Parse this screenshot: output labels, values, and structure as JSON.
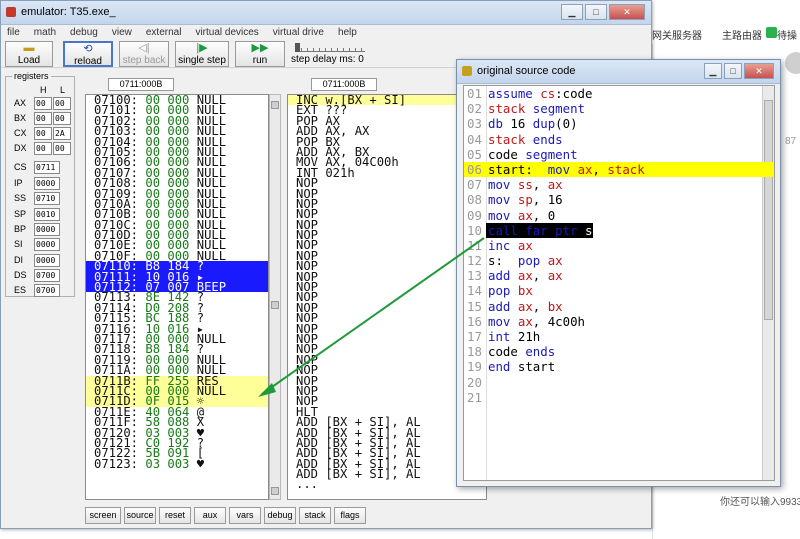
{
  "emulator": {
    "title": "emulator: T35.exe_",
    "menu": [
      "file",
      "math",
      "debug",
      "view",
      "external",
      "virtual devices",
      "virtual drive",
      "help"
    ],
    "toolbar": {
      "load": "Load",
      "reload": "reload",
      "step_back": "step back",
      "single_step": "single step",
      "run": "run",
      "step_delay": "step delay ms: 0"
    },
    "registers": {
      "title": "registers",
      "h": "H",
      "l": "L",
      "ax": {
        "name": "AX",
        "h": "00",
        "l": "00"
      },
      "bx": {
        "name": "BX",
        "h": "00",
        "l": "00"
      },
      "cx": {
        "name": "CX",
        "h": "00",
        "l": "2A"
      },
      "dx": {
        "name": "DX",
        "h": "00",
        "l": "00"
      },
      "cs": {
        "name": "CS",
        "v": "0711"
      },
      "ip": {
        "name": "IP",
        "v": "0000"
      },
      "ss": {
        "name": "SS",
        "v": "0710"
      },
      "sp": {
        "name": "SP",
        "v": "0010"
      },
      "bp": {
        "name": "BP",
        "v": "0000"
      },
      "si": {
        "name": "SI",
        "v": "0000"
      },
      "di": {
        "name": "DI",
        "v": "0000"
      },
      "ds": {
        "name": "DS",
        "v": "0700"
      },
      "es": {
        "name": "ES",
        "v": "0700"
      }
    },
    "mem_addr": "0711:000B",
    "dis_addr": "0711:000B",
    "memory": [
      {
        "addr": "07100:",
        "hex": " 00 000",
        "txt": " NULL"
      },
      {
        "addr": "07101:",
        "hex": " 00 000",
        "txt": " NULL"
      },
      {
        "addr": "07102:",
        "hex": " 00 000",
        "txt": " NULL"
      },
      {
        "addr": "07103:",
        "hex": " 00 000",
        "txt": " NULL"
      },
      {
        "addr": "07104:",
        "hex": " 00 000",
        "txt": " NULL"
      },
      {
        "addr": "07105:",
        "hex": " 00 000",
        "txt": " NULL"
      },
      {
        "addr": "07106:",
        "hex": " 00 000",
        "txt": " NULL"
      },
      {
        "addr": "07107:",
        "hex": " 00 000",
        "txt": " NULL"
      },
      {
        "addr": "07108:",
        "hex": " 00 000",
        "txt": " NULL"
      },
      {
        "addr": "07109:",
        "hex": " 00 000",
        "txt": " NULL"
      },
      {
        "addr": "0710A:",
        "hex": " 00 000",
        "txt": " NULL"
      },
      {
        "addr": "0710B:",
        "hex": " 00 000",
        "txt": " NULL"
      },
      {
        "addr": "0710C:",
        "hex": " 00 000",
        "txt": " NULL"
      },
      {
        "addr": "0710D:",
        "hex": " 00 000",
        "txt": " NULL"
      },
      {
        "addr": "0710E:",
        "hex": " 00 000",
        "txt": " NULL"
      },
      {
        "addr": "0710F:",
        "hex": " 00 000",
        "txt": " NULL"
      },
      {
        "addr": "07110:",
        "hex": " B8 184",
        "txt": " ?"
      },
      {
        "addr": "07111:",
        "hex": " 10 016",
        "txt": " ▸"
      },
      {
        "addr": "07112:",
        "hex": " 07 007",
        "txt": " BEEP"
      },
      {
        "addr": "07113:",
        "hex": " 8E 142",
        "txt": " ?"
      },
      {
        "addr": "07114:",
        "hex": " D0 208",
        "txt": " ?"
      },
      {
        "addr": "07115:",
        "hex": " BC 188",
        "txt": " ?"
      },
      {
        "addr": "07116:",
        "hex": " 10 016",
        "txt": " ▸"
      },
      {
        "addr": "07117:",
        "hex": " 00 000",
        "txt": " NULL"
      },
      {
        "addr": "07118:",
        "hex": " B8 184",
        "txt": " ?"
      },
      {
        "addr": "07119:",
        "hex": " 00 000",
        "txt": " NULL"
      },
      {
        "addr": "0711A:",
        "hex": " 00 000",
        "txt": " NULL"
      },
      {
        "addr": "0711B:",
        "hex": " FF 255",
        "txt": " RES"
      },
      {
        "addr": "0711C:",
        "hex": " 00 000",
        "txt": " NULL"
      },
      {
        "addr": "0711D:",
        "hex": " 0F 015",
        "txt": " ☼"
      },
      {
        "addr": "0711E:",
        "hex": " 40 064",
        "txt": " @"
      },
      {
        "addr": "0711F:",
        "hex": " 58 088",
        "txt": " X"
      },
      {
        "addr": "07120:",
        "hex": " 03 003",
        "txt": " ♥"
      },
      {
        "addr": "07121:",
        "hex": " C0 192",
        "txt": " ?"
      },
      {
        "addr": "07122:",
        "hex": " 5B 091",
        "txt": " ["
      },
      {
        "addr": "07123:",
        "hex": " 03 003",
        "txt": " ♥"
      }
    ],
    "disasm": [
      "INC w.[BX + SI]",
      "EXT ???",
      "POP AX",
      "ADD AX, AX",
      "POP BX",
      "ADD AX, BX",
      "MOV AX, 04C00h",
      "INT 021h",
      "NOP",
      "NOP",
      "NOP",
      "NOP",
      "NOP",
      "NOP",
      "NOP",
      "NOP",
      "NOP",
      "NOP",
      "NOP",
      "NOP",
      "NOP",
      "NOP",
      "NOP",
      "NOP",
      "NOP",
      "NOP",
      "NOP",
      "NOP",
      "NOP",
      "NOP",
      "HLT",
      "ADD [BX + SI], AL",
      "ADD [BX + SI], AL",
      "ADD [BX + SI], AL",
      "ADD [BX + SI], AL",
      "ADD [BX + SI], AL",
      "ADD [BX + SI], AL",
      "..."
    ],
    "bottom_buttons": [
      "screen",
      "source",
      "reset",
      "aux",
      "vars",
      "debug",
      "stack",
      "flags"
    ]
  },
  "source": {
    "title": "original source code",
    "lines": [
      {
        "n": "01",
        "t": "assume cs:code"
      },
      {
        "n": "02",
        "t": "stack segment"
      },
      {
        "n": "03",
        "t": "db 16 dup(0)"
      },
      {
        "n": "04",
        "t": "stack ends"
      },
      {
        "n": "05",
        "t": "code segment"
      },
      {
        "n": "06",
        "t": "start:  mov ax, stack"
      },
      {
        "n": "07",
        "t": "mov ss, ax"
      },
      {
        "n": "08",
        "t": "mov sp, 16"
      },
      {
        "n": "09",
        "t": "mov ax, 0"
      },
      {
        "n": "10",
        "t": "call far ptr s"
      },
      {
        "n": "11",
        "t": "inc ax"
      },
      {
        "n": "12",
        "t": "s:  pop ax"
      },
      {
        "n": "13",
        "t": "add ax, ax"
      },
      {
        "n": "14",
        "t": "pop bx"
      },
      {
        "n": "15",
        "t": "add ax, bx"
      },
      {
        "n": "16",
        "t": "mov ax, 4c00h"
      },
      {
        "n": "17",
        "t": "int 21h"
      },
      {
        "n": "18",
        "t": "code ends"
      },
      {
        "n": "19",
        "t": "end start"
      },
      {
        "n": "20",
        "t": ""
      },
      {
        "n": "21",
        "t": ""
      }
    ]
  },
  "background": {
    "tab1": "网关服务器",
    "tab2": "主路由器",
    "tab3": "待操",
    "note": "你还可以输入9933",
    "num": "87"
  },
  "colors": {
    "selection_blue": "#1a1aff",
    "highlight_yellow": "#ffff99",
    "source_highlight": "#ffff00",
    "arrow_green": "#1f9a3a"
  }
}
